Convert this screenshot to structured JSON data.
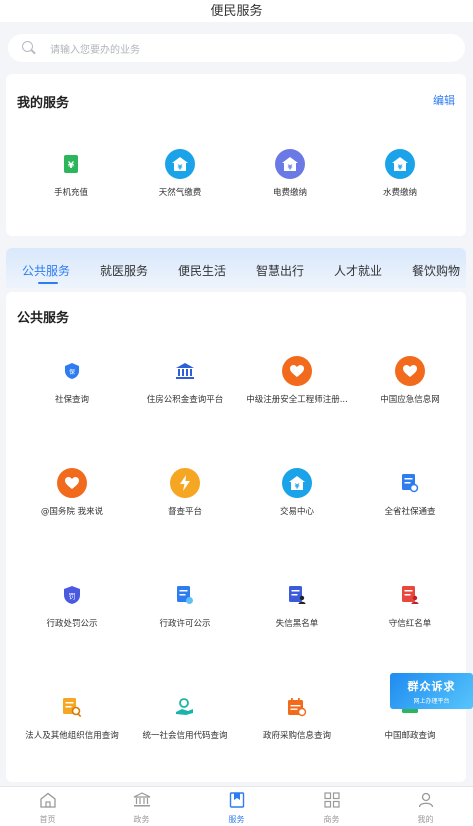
{
  "header": {
    "title": "便民服务"
  },
  "search": {
    "placeholder": "请输入您要办的业务"
  },
  "my_services": {
    "title": "我的服务",
    "edit_label": "编辑",
    "items": [
      {
        "label": "手机充值",
        "icon": "phone-recharge-icon",
        "color": "#2db55d"
      },
      {
        "label": "天然气缴费",
        "icon": "gas-fee-icon",
        "color": "#1aa3e8"
      },
      {
        "label": "电费缴纳",
        "icon": "electricity-fee-icon",
        "color": "#6b79e6"
      },
      {
        "label": "水费缴纳",
        "icon": "water-fee-icon",
        "color": "#1aa3e8"
      }
    ]
  },
  "tabs": [
    {
      "label": "公共服务",
      "active": true
    },
    {
      "label": "就医服务"
    },
    {
      "label": "便民生活"
    },
    {
      "label": "智慧出行"
    },
    {
      "label": "人才就业"
    },
    {
      "label": "餐饮购物"
    }
  ],
  "public_services": {
    "title": "公共服务",
    "items": [
      {
        "label": "社保查询",
        "icon": "social-security-icon",
        "color": "#2d7cf0"
      },
      {
        "label": "住房公积金查询平台",
        "icon": "bank-icon",
        "color": "#2d5fd8"
      },
      {
        "label": "中级注册安全工程师注册...",
        "icon": "heart-hand-icon",
        "color": "#f26a1b"
      },
      {
        "label": "中国应急信息网",
        "icon": "heart-hand-icon",
        "color": "#f26a1b"
      },
      {
        "label": "@国务院 我来说",
        "icon": "heart-hand-icon",
        "color": "#f26a1b"
      },
      {
        "label": "督查平台",
        "icon": "lightning-icon",
        "color": "#f5a623"
      },
      {
        "label": "交易中心",
        "icon": "yuan-house-icon",
        "color": "#1aa3e8"
      },
      {
        "label": "全省社保通查",
        "icon": "document-search-icon",
        "color": "#2d7cf0"
      },
      {
        "label": "行政处罚公示",
        "icon": "penalty-shield-icon",
        "color": "#4a5ae0"
      },
      {
        "label": "行政许可公示",
        "icon": "permit-document-icon",
        "color": "#2d7cf0"
      },
      {
        "label": "失信黑名单",
        "icon": "blacklist-icon",
        "color": "#3b5bdb"
      },
      {
        "label": "守信红名单",
        "icon": "redlist-icon",
        "color": "#e8473e"
      },
      {
        "label": "法人及其他组织信用查询",
        "icon": "credit-search-icon",
        "color": "#f5a623"
      },
      {
        "label": "统一社会信用代码查询",
        "icon": "hand-search-icon",
        "color": "#19b5a8"
      },
      {
        "label": "政府采购信息查询",
        "icon": "calendar-icon",
        "color": "#f26a1b"
      },
      {
        "label": "中国邮政查询",
        "icon": "post-icon",
        "color": "#2db55d"
      }
    ]
  },
  "floater": {
    "big": "群众诉求",
    "small": "网上办理平台"
  },
  "tabbar": [
    {
      "label": "首页",
      "icon": "home-icon"
    },
    {
      "label": "政务",
      "icon": "government-icon"
    },
    {
      "label": "服务",
      "icon": "service-bookmark-icon",
      "active": true
    },
    {
      "label": "商务",
      "icon": "grid-icon"
    },
    {
      "label": "我的",
      "icon": "profile-icon"
    }
  ]
}
